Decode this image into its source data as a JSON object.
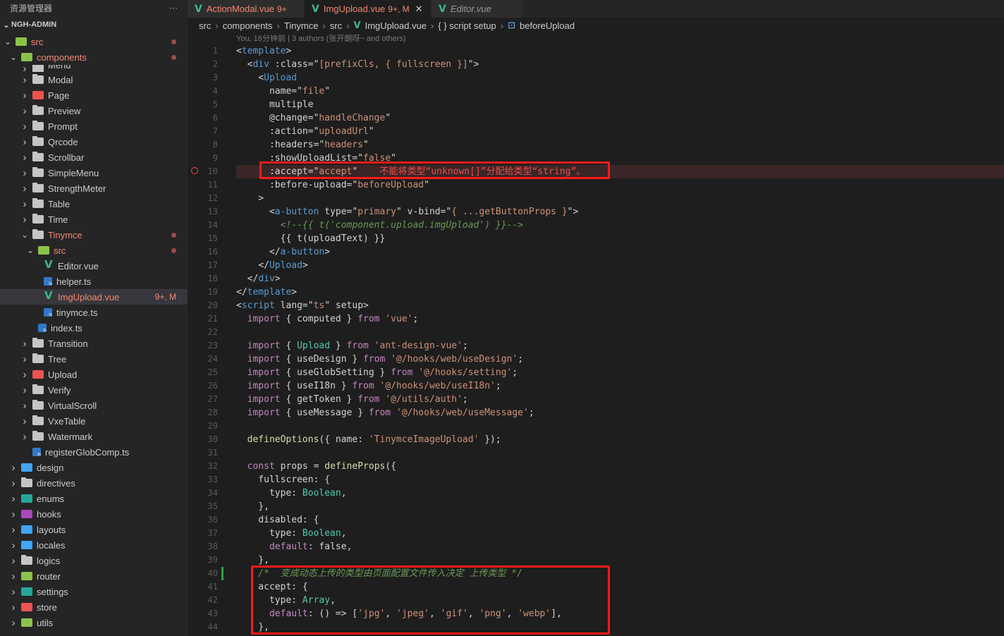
{
  "sidebar": {
    "title": "资源管理器",
    "more": "···",
    "project": "NGH-ADMIN",
    "tree": [
      {
        "label": "src",
        "depth": 0,
        "open": true,
        "icon": "src",
        "dot": true,
        "style": "err"
      },
      {
        "label": "components",
        "depth": 1,
        "open": true,
        "icon": "src",
        "dot": true,
        "style": "err"
      },
      {
        "label": "Menu",
        "depth": 2,
        "open": false,
        "icon": "folder",
        "partial": true
      },
      {
        "label": "Modal",
        "depth": 2,
        "open": false,
        "icon": "folder"
      },
      {
        "label": "Page",
        "depth": 2,
        "open": false,
        "icon": "red"
      },
      {
        "label": "Preview",
        "depth": 2,
        "open": false,
        "icon": "folder"
      },
      {
        "label": "Prompt",
        "depth": 2,
        "open": false,
        "icon": "folder"
      },
      {
        "label": "Qrcode",
        "depth": 2,
        "open": false,
        "icon": "folder"
      },
      {
        "label": "Scrollbar",
        "depth": 2,
        "open": false,
        "icon": "folder"
      },
      {
        "label": "SimpleMenu",
        "depth": 2,
        "open": false,
        "icon": "folder"
      },
      {
        "label": "StrengthMeter",
        "depth": 2,
        "open": false,
        "icon": "folder"
      },
      {
        "label": "Table",
        "depth": 2,
        "open": false,
        "icon": "folder"
      },
      {
        "label": "Time",
        "depth": 2,
        "open": false,
        "icon": "folder"
      },
      {
        "label": "Tinymce",
        "depth": 2,
        "open": true,
        "icon": "folder",
        "dot": true,
        "style": "err"
      },
      {
        "label": "src",
        "depth": 3,
        "open": true,
        "icon": "src",
        "dot": true,
        "style": "err"
      },
      {
        "label": "Editor.vue",
        "depth": 4,
        "icon": "vue",
        "file": true
      },
      {
        "label": "helper.ts",
        "depth": 4,
        "icon": "ts",
        "file": true
      },
      {
        "label": "ImgUpload.vue",
        "depth": 4,
        "icon": "vue",
        "file": true,
        "selected": true,
        "badge": "9+, M",
        "style": "err"
      },
      {
        "label": "tinymce.ts",
        "depth": 4,
        "icon": "ts",
        "file": true
      },
      {
        "label": "index.ts",
        "depth": 3,
        "icon": "ts",
        "file": true
      },
      {
        "label": "Transition",
        "depth": 2,
        "open": false,
        "icon": "folder"
      },
      {
        "label": "Tree",
        "depth": 2,
        "open": false,
        "icon": "folder"
      },
      {
        "label": "Upload",
        "depth": 2,
        "open": false,
        "icon": "red"
      },
      {
        "label": "Verify",
        "depth": 2,
        "open": false,
        "icon": "folder"
      },
      {
        "label": "VirtualScroll",
        "depth": 2,
        "open": false,
        "icon": "folder"
      },
      {
        "label": "VxeTable",
        "depth": 2,
        "open": false,
        "icon": "folder"
      },
      {
        "label": "Watermark",
        "depth": 2,
        "open": false,
        "icon": "folder"
      },
      {
        "label": "registerGlobComp.ts",
        "depth": 2,
        "icon": "ts",
        "file": true
      },
      {
        "label": "design",
        "depth": 1,
        "open": false,
        "icon": "blue"
      },
      {
        "label": "directives",
        "depth": 1,
        "open": false,
        "icon": "folder"
      },
      {
        "label": "enums",
        "depth": 1,
        "open": false,
        "icon": "teal"
      },
      {
        "label": "hooks",
        "depth": 1,
        "open": false,
        "icon": "purple"
      },
      {
        "label": "layouts",
        "depth": 1,
        "open": false,
        "icon": "blue"
      },
      {
        "label": "locales",
        "depth": 1,
        "open": false,
        "icon": "blue"
      },
      {
        "label": "logics",
        "depth": 1,
        "open": false,
        "icon": "folder"
      },
      {
        "label": "router",
        "depth": 1,
        "open": false,
        "icon": "src"
      },
      {
        "label": "settings",
        "depth": 1,
        "open": false,
        "icon": "teal"
      },
      {
        "label": "store",
        "depth": 1,
        "open": false,
        "icon": "red"
      },
      {
        "label": "utils",
        "depth": 1,
        "open": false,
        "icon": "src"
      }
    ]
  },
  "tabs": [
    {
      "name": "ActionModal.vue",
      "badge": "9+",
      "active": false,
      "preview": false
    },
    {
      "name": "ImgUpload.vue",
      "badge": "9+, M",
      "active": true,
      "preview": false,
      "close": "✕"
    },
    {
      "name": "Editor.vue",
      "badge": "",
      "active": false,
      "preview": true
    }
  ],
  "breadcrumb": [
    "src",
    "components",
    "Tinymce",
    "src",
    "ImgUpload.vue",
    "{ } script setup",
    "beforeUpload"
  ],
  "blame": "You, 16分钟前 | 3 authors (张开朗呀~ and others)",
  "error_message": "不能将类型“unknown[]”分配给类型“string”。",
  "code_lines": [
    "<template>",
    "  <div :class=\"[prefixCls, { fullscreen }]\">",
    "    <Upload",
    "      name=\"file\"",
    "      multiple",
    "      @change=\"handleChange\"",
    "      :action=\"uploadUrl\"",
    "      :headers=\"headers\"",
    "      :showUploadList=\"false\"",
    "      :accept=\"accept\"",
    "      :before-upload=\"beforeUpload\"",
    "    >",
    "      <a-button type=\"primary\" v-bind=\"{ ...getButtonProps }\">",
    "        <!--{{ t('component.upload.imgUpload') }}-->",
    "        {{ t(uploadText) }}",
    "      </a-button>",
    "    </Upload>",
    "  </div>",
    "</template>",
    "<script lang=\"ts\" setup>",
    "  import { computed } from 'vue';",
    "",
    "  import { Upload } from 'ant-design-vue';",
    "  import { useDesign } from '@/hooks/web/useDesign';",
    "  import { useGlobSetting } from '@/hooks/setting';",
    "  import { useI18n } from '@/hooks/web/useI18n';",
    "  import { getToken } from '@/utils/auth';",
    "  import { useMessage } from '@/hooks/web/useMessage';",
    "",
    "  defineOptions({ name: 'TinymceImageUpload' });",
    "",
    "  const props = defineProps({",
    "    fullscreen: {",
    "      type: Boolean,",
    "    },",
    "    disabled: {",
    "      type: Boolean,",
    "      default: false,",
    "    },",
    "    /*  变成动态上传的类型由页面配置文件传入决定 上传类型 */",
    "    accept: {",
    "      type: Array,",
    "      default: () => ['jpg', 'jpeg', 'gif', 'png', 'webp'],",
    "    },"
  ]
}
